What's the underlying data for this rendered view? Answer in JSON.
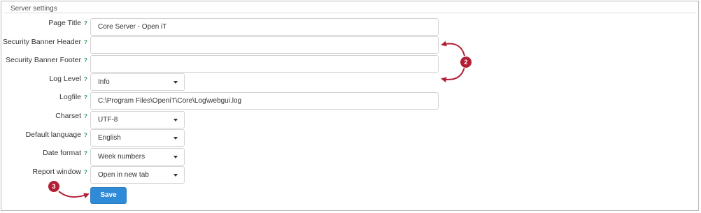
{
  "section": {
    "title": "Server settings"
  },
  "help_mark": "?",
  "fields": {
    "page_title": {
      "label": "Page Title",
      "value": "Core Server - Open iT"
    },
    "banner_header": {
      "label": "Security Banner Header",
      "value": ""
    },
    "banner_footer": {
      "label": "Security Banner Footer",
      "value": ""
    },
    "log_level": {
      "label": "Log Level",
      "value": "Info"
    },
    "logfile": {
      "label": "Logfile",
      "value": "C:\\Program Files\\OpeniT\\Core\\Log\\webgui.log"
    },
    "charset": {
      "label": "Charset",
      "value": "UTF-8"
    },
    "default_language": {
      "label": "Default language",
      "value": "English"
    },
    "date_format": {
      "label": "Date format",
      "value": "Week numbers"
    },
    "report_window": {
      "label": "Report window",
      "value": "Open in new tab"
    }
  },
  "save_button": {
    "label": "Save",
    "color": "#2f8ad8"
  },
  "callouts": [
    {
      "number": "2",
      "color": "#b21f35"
    },
    {
      "number": "3",
      "color": "#b21f35"
    }
  ]
}
